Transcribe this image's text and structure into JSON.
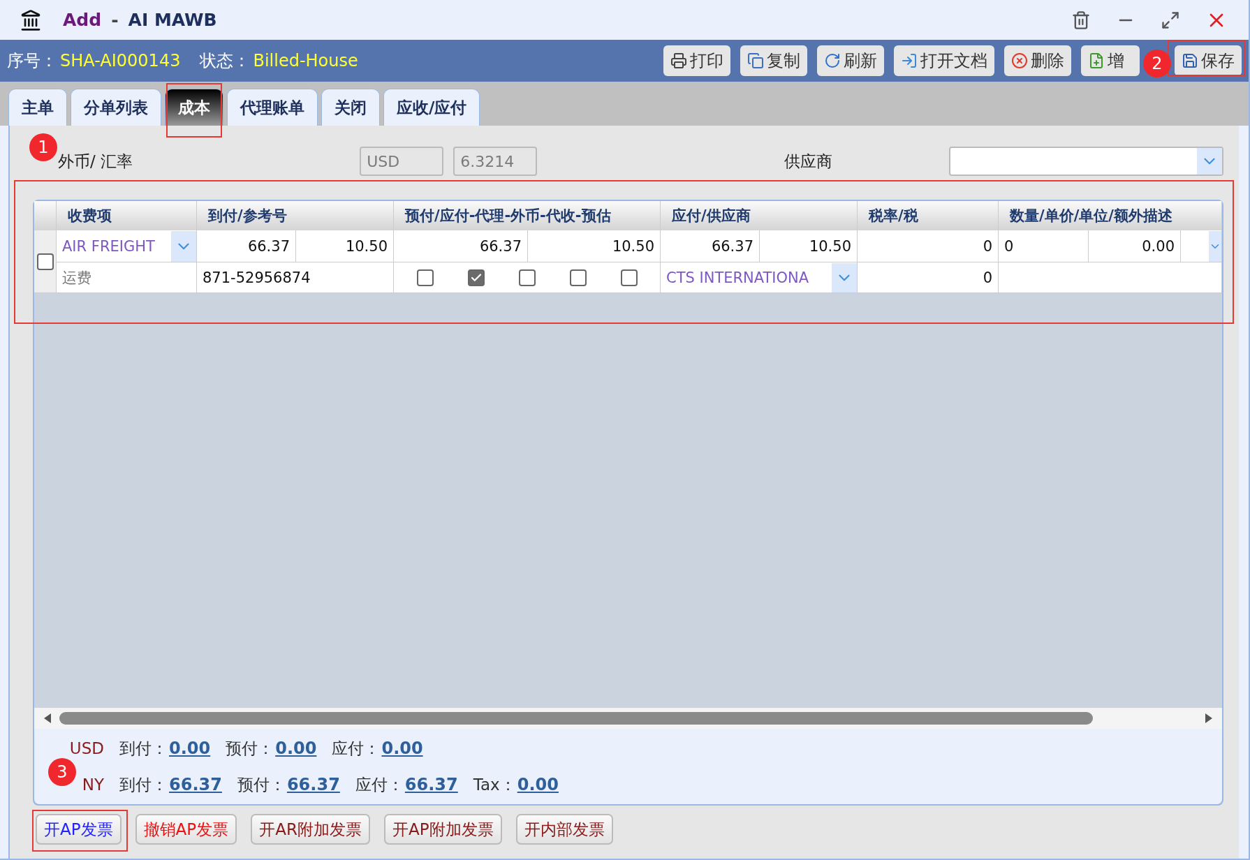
{
  "window": {
    "action": "Add",
    "separator": "-",
    "title": "AI MAWB"
  },
  "info": [
    {
      "label": "序号：",
      "value": "SHA-AI000143"
    },
    {
      "label": "状态：",
      "value": "Billed-House"
    }
  ],
  "toolbar": [
    {
      "kind": "print",
      "label": "打印"
    },
    {
      "kind": "copy",
      "label": "复制"
    },
    {
      "kind": "refresh",
      "label": "刷新"
    },
    {
      "kind": "open",
      "label": "打开文档"
    },
    {
      "kind": "delete",
      "label": "删除"
    },
    {
      "kind": "add",
      "label": "增"
    },
    {
      "kind": "save",
      "label": "保存",
      "highlighted": true,
      "marker": "2"
    }
  ],
  "tabs": [
    {
      "label": "主单",
      "selected": false
    },
    {
      "label": "分单列表",
      "selected": false
    },
    {
      "label": "成本",
      "selected": true,
      "highlighted": true
    },
    {
      "label": "代理账单",
      "selected": false
    },
    {
      "label": "关闭",
      "selected": false
    },
    {
      "label": "应收/应付",
      "selected": false
    }
  ],
  "filters": {
    "currency_label": "外币/ 汇率",
    "currency": {
      "value": "USD",
      "disabled": true
    },
    "rate": {
      "value": "6.3214",
      "disabled": true
    },
    "vendor_label": "供应商"
  },
  "table": {
    "highlighted": true,
    "marker": "1",
    "columns": [
      "收费项",
      "到付/参考号",
      "预付/应付-代理-外币-代收-预估",
      "应付/供应商",
      "税率/税",
      "数量/单价/单位/额外描述"
    ],
    "rows": [
      {
        "checked": false,
        "charge": "AIR FREIGHT",
        "charge_desc": "运费",
        "collect": "66.37",
        "collect_2": "10.50",
        "ref": "871-52956874",
        "prepaid": "66.37",
        "prepaid_2": "10.50",
        "flags": [
          false,
          true,
          false,
          false,
          false
        ],
        "payable": "66.37",
        "payable_2": "10.50",
        "vendor": "CTS INTERNATIONA",
        "tax_rate": "0",
        "tax": "0",
        "qty": "0",
        "unit_price": "0.00"
      }
    ]
  },
  "summary": [
    {
      "currency": "USD",
      "items": [
        {
          "label": "到付：",
          "value": "0.00"
        },
        {
          "label": "预付：",
          "value": "0.00"
        },
        {
          "label": "应付：",
          "value": "0.00"
        }
      ]
    },
    {
      "currency": "NY",
      "marker": "3",
      "items": [
        {
          "label": "到付：",
          "value": "66.37"
        },
        {
          "label": "预付：",
          "value": "66.37"
        },
        {
          "label": "应付：",
          "value": "66.37"
        },
        {
          "label": "Tax：",
          "value": "0.00"
        }
      ]
    }
  ],
  "actions": [
    {
      "label": "开AP发票",
      "kind": "primary",
      "highlighted": true
    },
    {
      "label": "撤销AP发票",
      "kind": "danger"
    },
    {
      "label": "开AR附加发票",
      "kind": "normal"
    },
    {
      "label": "开AP附加发票",
      "kind": "normal"
    },
    {
      "label": "开内部发票",
      "kind": "normal"
    }
  ]
}
